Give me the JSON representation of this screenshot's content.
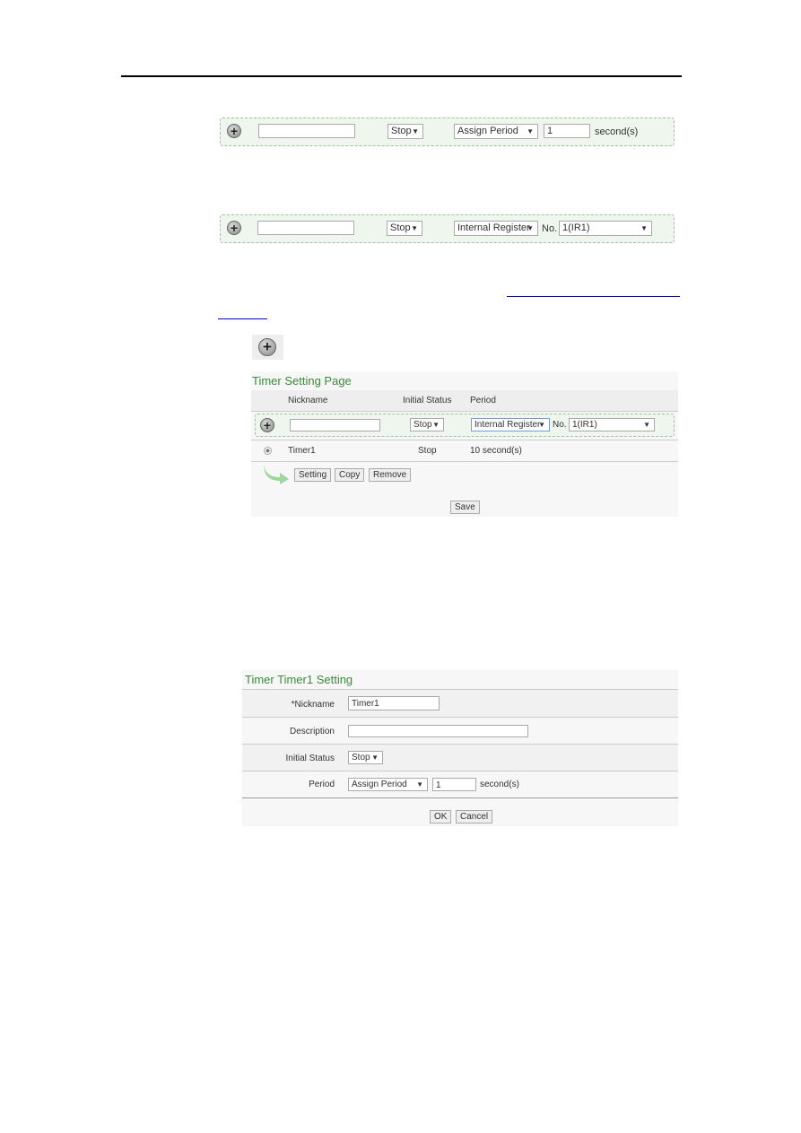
{
  "row1": {
    "nickname": "",
    "status": "Stop",
    "period_type": "Assign Period",
    "period_value": "1",
    "unit": "second(s)"
  },
  "row2": {
    "nickname": "",
    "status": "Stop",
    "period_type": "Internal Register",
    "no_label": "No.",
    "register": "1(IR1)"
  },
  "add_button_icon": "plus-circle-icon",
  "timer_page": {
    "title": "Timer Setting Page",
    "headers": [
      "Nickname",
      "Initial Status",
      "Period"
    ],
    "add_row": {
      "nickname": "",
      "status": "Stop",
      "period_type": "Internal Register",
      "no_label": "No.",
      "register": "1(IR1)"
    },
    "rows": [
      {
        "nickname": "Timer1",
        "status": "Stop",
        "period": "10 second(s)"
      }
    ],
    "actions": [
      "Setting",
      "Copy",
      "Remove"
    ],
    "save": "Save"
  },
  "timer_setting": {
    "title": "Timer Timer1 Setting",
    "nickname_label": "*Nickname",
    "nickname": "Timer1",
    "description_label": "Description",
    "description": "",
    "status_label": "Initial Status",
    "status": "Stop",
    "period_label": "Period",
    "period_type": "Assign Period",
    "period_value": "1",
    "unit": "second(s)",
    "ok": "OK",
    "cancel": "Cancel"
  },
  "colors": {
    "title_green": "#3b8a3b",
    "dashed_bg": "#eef6ee",
    "link": "#0000cc"
  }
}
